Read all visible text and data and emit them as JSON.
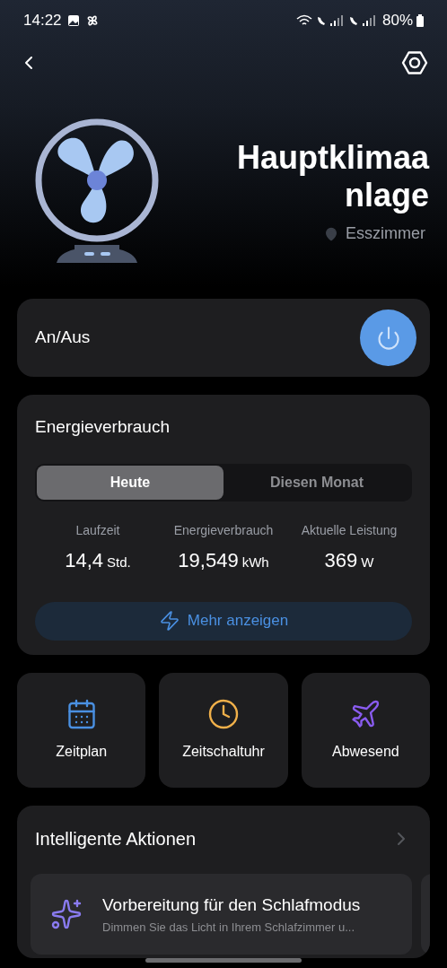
{
  "status_bar": {
    "time": "14:22",
    "battery": "80%"
  },
  "device": {
    "name": "Hauptklimaanlage",
    "location": "Esszimmer"
  },
  "power": {
    "label": "An/Aus",
    "on": true
  },
  "energy": {
    "title": "Energieverbrauch",
    "tabs": [
      {
        "label": "Heute",
        "selected": true
      },
      {
        "label": "Diesen Monat",
        "selected": false
      }
    ],
    "stats": [
      {
        "label": "Laufzeit",
        "value": "14,4",
        "unit": "Std."
      },
      {
        "label": "Energieverbrauch",
        "value": "19,549",
        "unit": "kWh"
      },
      {
        "label": "Aktuelle Leistung",
        "value": "369",
        "unit": "W"
      }
    ],
    "more_button": "Mehr anzeigen"
  },
  "tiles": [
    {
      "label": "Zeitplan",
      "kind": "schedule"
    },
    {
      "label": "Zeitschaltuhr",
      "kind": "timer"
    },
    {
      "label": "Abwesend",
      "kind": "away"
    }
  ],
  "smart_actions": {
    "title": "Intelligente Aktionen",
    "items": [
      {
        "title": "Vorbereitung für den Schlafmodus",
        "description": "Dimmen Sie das Licht in Ihrem Schlafzimmer u..."
      }
    ]
  }
}
